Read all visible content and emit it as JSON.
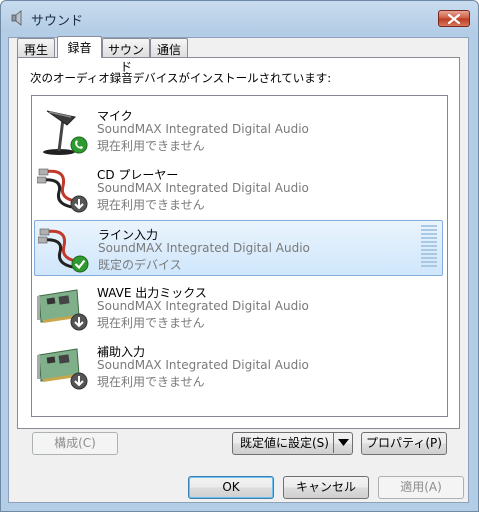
{
  "window": {
    "title": "サウンド"
  },
  "tabs": [
    {
      "label": "再生",
      "active": false
    },
    {
      "label": "録音",
      "active": true
    },
    {
      "label": "サウンド",
      "active": false
    },
    {
      "label": "通信",
      "active": false
    }
  ],
  "recording": {
    "prompt": "次のオーディオ録音デバイスがインストールされています:",
    "devices": [
      {
        "name": "マイク",
        "driver": "SoundMAX Integrated Digital Audio",
        "status": "現在利用できません",
        "icon": "microphone-icon",
        "badge": "phone-badge-icon",
        "selected": false
      },
      {
        "name": "CD プレーヤー",
        "driver": "SoundMAX Integrated Digital Audio",
        "status": "現在利用できません",
        "icon": "rca-cable-icon",
        "badge": "down-arrow-badge-icon",
        "selected": false
      },
      {
        "name": "ライン入力",
        "driver": "SoundMAX Integrated Digital Audio",
        "status": "既定のデバイス",
        "icon": "rca-cable-icon",
        "badge": "checkmark-badge-icon",
        "selected": true
      },
      {
        "name": "WAVE 出力ミックス",
        "driver": "SoundMAX Integrated Digital Audio",
        "status": "現在利用できません",
        "icon": "sound-card-icon",
        "badge": "down-arrow-badge-icon",
        "selected": false
      },
      {
        "name": "補助入力",
        "driver": "SoundMAX Integrated Digital Audio",
        "status": "現在利用できません",
        "icon": "sound-card-icon",
        "badge": "down-arrow-badge-icon",
        "selected": false
      }
    ]
  },
  "buttons": {
    "configure": "構成(C)",
    "set_default": "既定値に設定(S)",
    "properties": "プロパティ(P)",
    "ok": "OK",
    "cancel": "キャンセル",
    "apply": "適用(A)"
  },
  "colors": {
    "selection_bg": "#cfe6fb",
    "selection_border": "#84acdd",
    "check_green": "#2f9a2f"
  }
}
